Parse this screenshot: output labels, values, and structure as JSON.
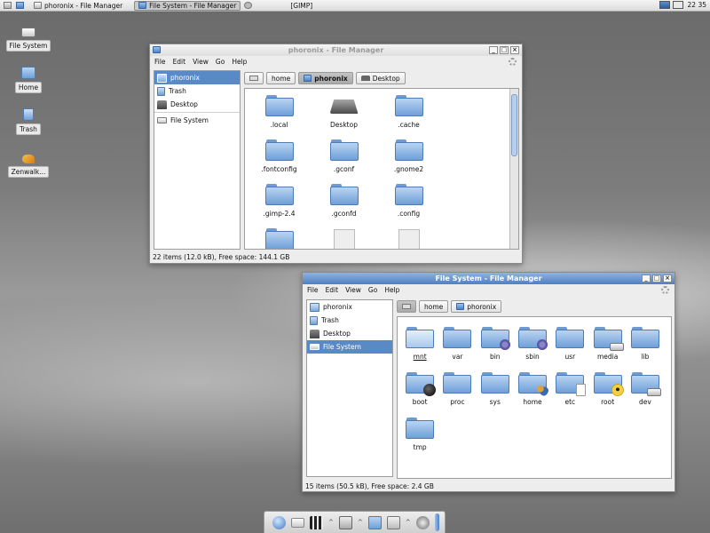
{
  "top_panel": {
    "tasks": [
      {
        "label": "phoronix - File Manager",
        "active": false
      },
      {
        "label": "File System - File Manager",
        "active": true
      },
      {
        "label": "[GIMP]",
        "active": false
      }
    ],
    "clock": "22 35"
  },
  "desktop_icons": [
    {
      "label": "File System",
      "icon": "drive-icon"
    },
    {
      "label": "Home",
      "icon": "home-folder-icon"
    },
    {
      "label": "Trash",
      "icon": "trash-icon"
    },
    {
      "label": "Zenwalk...",
      "icon": "zenwalk-icon"
    }
  ],
  "window1": {
    "title": "phoronix - File Manager",
    "menu": [
      "File",
      "Edit",
      "View",
      "Go",
      "Help"
    ],
    "sidebar": [
      {
        "label": "phoronix",
        "icon": "home-folder-icon",
        "selected": true
      },
      {
        "label": "Trash",
        "icon": "trash-icon",
        "selected": false
      },
      {
        "label": "Desktop",
        "icon": "desktop-icon",
        "selected": false
      },
      {
        "label": "File System",
        "icon": "drive-icon",
        "selected": false
      }
    ],
    "path": [
      {
        "label": "home",
        "selected": false
      },
      {
        "label": "phoronix",
        "selected": true
      },
      {
        "label": "Desktop",
        "selected": false
      }
    ],
    "files": [
      ".local",
      "Desktop",
      ".cache",
      ".fontconfig",
      ".gconf",
      ".gnome2",
      ".gimp-2.4",
      ".gconfd",
      ".config"
    ],
    "status": "22 items (12.0 kB), Free space: 144.1 GB"
  },
  "window2": {
    "title": "File System - File Manager",
    "menu": [
      "File",
      "Edit",
      "View",
      "Go",
      "Help"
    ],
    "sidebar": [
      {
        "label": "phoronix",
        "icon": "home-folder-icon",
        "selected": false
      },
      {
        "label": "Trash",
        "icon": "trash-icon",
        "selected": false
      },
      {
        "label": "Desktop",
        "icon": "desktop-icon",
        "selected": false
      },
      {
        "label": "File System",
        "icon": "drive-icon",
        "selected": true
      }
    ],
    "path": [
      {
        "label": "home",
        "selected": false
      },
      {
        "label": "phoronix",
        "selected": false
      }
    ],
    "files": [
      "mnt",
      "var",
      "bin",
      "sbin",
      "usr",
      "media",
      "lib",
      "boot",
      "proc",
      "sys",
      "home",
      "etc",
      "root",
      "dev",
      "tmp"
    ],
    "status": "15 items (50.5 kB), Free space: 2.4 GB"
  },
  "colors": {
    "selection": "#5a8ac6",
    "folder": "#8fb6e4",
    "active_title": "#4f80c2"
  }
}
